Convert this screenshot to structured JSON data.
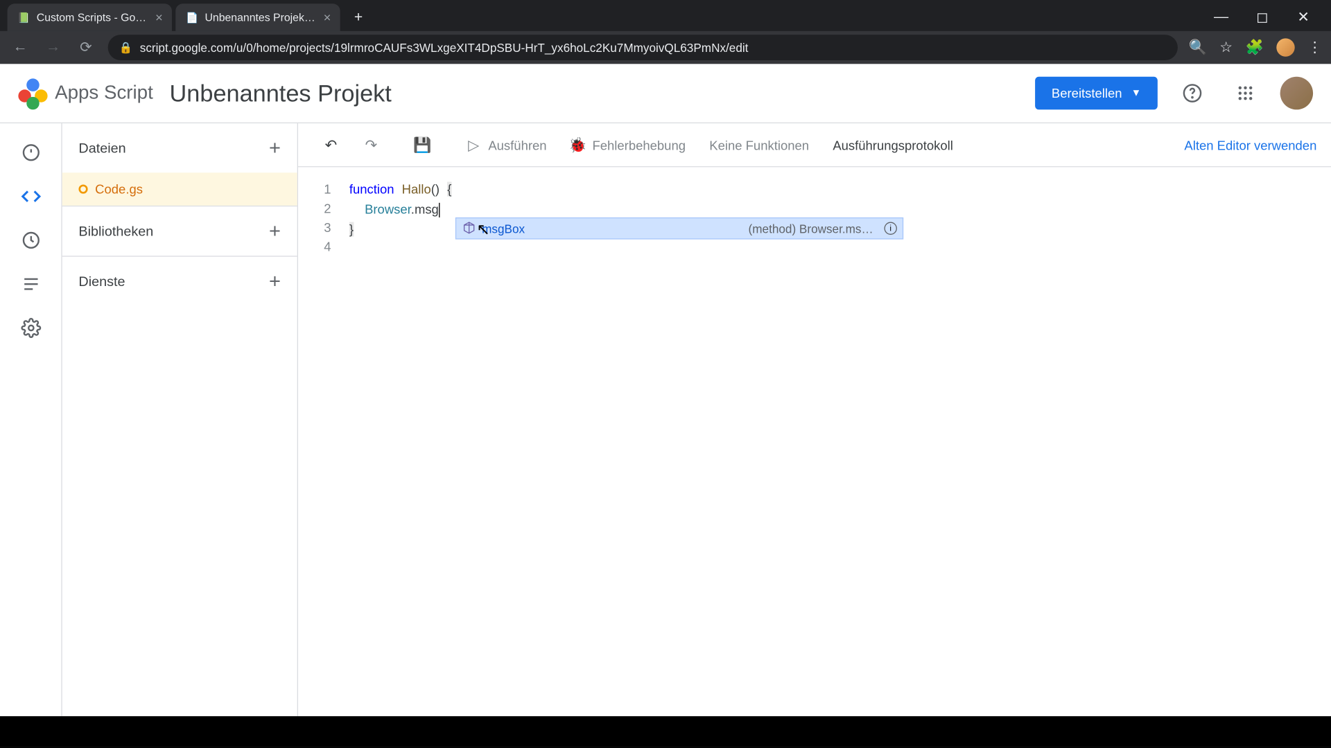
{
  "browser": {
    "tabs": [
      {
        "title": "Custom Scripts - Google Tabellen",
        "favicon": "📗"
      },
      {
        "title": "Unbenanntes Projekt - Projekt-E",
        "favicon": "📄"
      }
    ],
    "url": "script.google.com/u/0/home/projects/19lrmroCAUFs3WLxgeXIT4DpSBU-HrT_yx6hoLc2Ku7MmyoivQL63PmNx/edit"
  },
  "header": {
    "app_name": "Apps Script",
    "project_title": "Unbenanntes Projekt",
    "deploy_label": "Bereitstellen"
  },
  "sidepanel": {
    "files_label": "Dateien",
    "libraries_label": "Bibliotheken",
    "services_label": "Dienste",
    "files": [
      {
        "name": "Code.gs"
      }
    ]
  },
  "toolbar": {
    "run_label": "Ausführen",
    "debug_label": "Fehlerbehebung",
    "func_dropdown": "Keine Funktionen",
    "log_label": "Ausführungsprotokoll",
    "legacy_label": "Alten Editor verwenden"
  },
  "code": {
    "line_numbers": [
      "1",
      "2",
      "3",
      "4"
    ],
    "l1_kw": "function",
    "l1_fn": "Hallo",
    "l1_paren": "()",
    "l1_brace": "{",
    "l2_obj": "Browser",
    "l2_dot": ".",
    "l2_partial": "msg",
    "l3_brace": "}"
  },
  "autocomplete": {
    "suggestion": "msgBox",
    "signature": "(method) Browser.ms…"
  }
}
